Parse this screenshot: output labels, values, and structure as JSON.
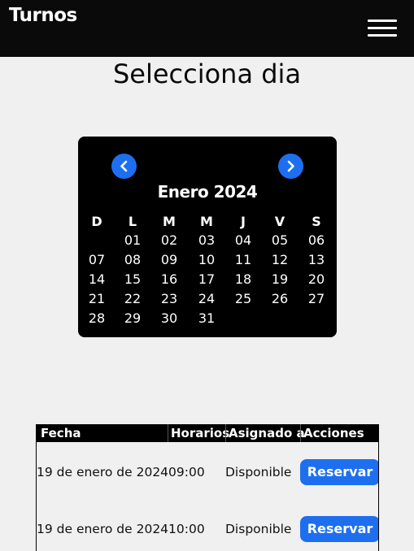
{
  "header": {
    "brand": "Turnos",
    "menu_icon": "hamburger-menu-icon"
  },
  "page": {
    "title": "Selecciona dia"
  },
  "calendar": {
    "month_label": "Enero 2024",
    "prev_icon": "chevron-left-icon",
    "next_icon": "chevron-right-icon",
    "weekdays": [
      "D",
      "L",
      "M",
      "M",
      "J",
      "V",
      "S"
    ],
    "weeks": [
      [
        "",
        "01",
        "02",
        "03",
        "04",
        "05",
        "06"
      ],
      [
        "07",
        "08",
        "09",
        "10",
        "11",
        "12",
        "13"
      ],
      [
        "14",
        "15",
        "16",
        "17",
        "18",
        "19",
        "20"
      ],
      [
        "21",
        "22",
        "23",
        "24",
        "25",
        "26",
        "27"
      ],
      [
        "28",
        "29",
        "30",
        "31",
        "",
        "",
        ""
      ]
    ]
  },
  "table": {
    "headers": {
      "fecha": "Fecha",
      "horarios": "Horarios",
      "asignado": "Asignado a",
      "acciones": "Acciones"
    },
    "rows": [
      {
        "fecha_horario": "19 de enero de 202409:00",
        "asignado": "Disponible",
        "action": "Reservar"
      },
      {
        "fecha_horario": "19 de enero de 202410:00",
        "asignado": "Disponible",
        "action": "Reservar"
      }
    ]
  },
  "colors": {
    "accent": "#1e6ff0",
    "header_bg": "#0a0a0a",
    "page_bg": "#f0f0f0"
  }
}
